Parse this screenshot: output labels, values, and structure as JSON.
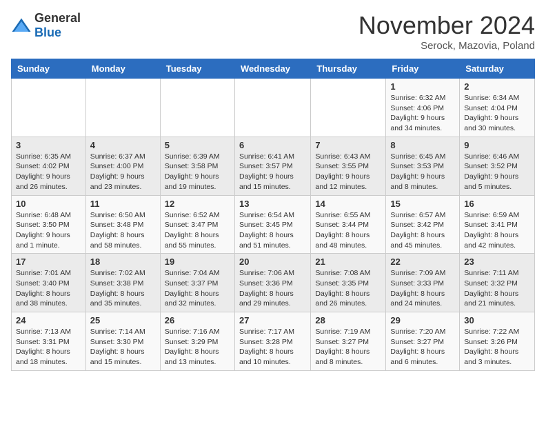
{
  "header": {
    "logo_general": "General",
    "logo_blue": "Blue",
    "month": "November 2024",
    "location": "Serock, Mazovia, Poland"
  },
  "weekdays": [
    "Sunday",
    "Monday",
    "Tuesday",
    "Wednesday",
    "Thursday",
    "Friday",
    "Saturday"
  ],
  "weeks": [
    [
      {
        "day": "",
        "info": ""
      },
      {
        "day": "",
        "info": ""
      },
      {
        "day": "",
        "info": ""
      },
      {
        "day": "",
        "info": ""
      },
      {
        "day": "",
        "info": ""
      },
      {
        "day": "1",
        "info": "Sunrise: 6:32 AM\nSunset: 4:06 PM\nDaylight: 9 hours\nand 34 minutes."
      },
      {
        "day": "2",
        "info": "Sunrise: 6:34 AM\nSunset: 4:04 PM\nDaylight: 9 hours\nand 30 minutes."
      }
    ],
    [
      {
        "day": "3",
        "info": "Sunrise: 6:35 AM\nSunset: 4:02 PM\nDaylight: 9 hours\nand 26 minutes."
      },
      {
        "day": "4",
        "info": "Sunrise: 6:37 AM\nSunset: 4:00 PM\nDaylight: 9 hours\nand 23 minutes."
      },
      {
        "day": "5",
        "info": "Sunrise: 6:39 AM\nSunset: 3:58 PM\nDaylight: 9 hours\nand 19 minutes."
      },
      {
        "day": "6",
        "info": "Sunrise: 6:41 AM\nSunset: 3:57 PM\nDaylight: 9 hours\nand 15 minutes."
      },
      {
        "day": "7",
        "info": "Sunrise: 6:43 AM\nSunset: 3:55 PM\nDaylight: 9 hours\nand 12 minutes."
      },
      {
        "day": "8",
        "info": "Sunrise: 6:45 AM\nSunset: 3:53 PM\nDaylight: 9 hours\nand 8 minutes."
      },
      {
        "day": "9",
        "info": "Sunrise: 6:46 AM\nSunset: 3:52 PM\nDaylight: 9 hours\nand 5 minutes."
      }
    ],
    [
      {
        "day": "10",
        "info": "Sunrise: 6:48 AM\nSunset: 3:50 PM\nDaylight: 9 hours\nand 1 minute."
      },
      {
        "day": "11",
        "info": "Sunrise: 6:50 AM\nSunset: 3:48 PM\nDaylight: 8 hours\nand 58 minutes."
      },
      {
        "day": "12",
        "info": "Sunrise: 6:52 AM\nSunset: 3:47 PM\nDaylight: 8 hours\nand 55 minutes."
      },
      {
        "day": "13",
        "info": "Sunrise: 6:54 AM\nSunset: 3:45 PM\nDaylight: 8 hours\nand 51 minutes."
      },
      {
        "day": "14",
        "info": "Sunrise: 6:55 AM\nSunset: 3:44 PM\nDaylight: 8 hours\nand 48 minutes."
      },
      {
        "day": "15",
        "info": "Sunrise: 6:57 AM\nSunset: 3:42 PM\nDaylight: 8 hours\nand 45 minutes."
      },
      {
        "day": "16",
        "info": "Sunrise: 6:59 AM\nSunset: 3:41 PM\nDaylight: 8 hours\nand 42 minutes."
      }
    ],
    [
      {
        "day": "17",
        "info": "Sunrise: 7:01 AM\nSunset: 3:40 PM\nDaylight: 8 hours\nand 38 minutes."
      },
      {
        "day": "18",
        "info": "Sunrise: 7:02 AM\nSunset: 3:38 PM\nDaylight: 8 hours\nand 35 minutes."
      },
      {
        "day": "19",
        "info": "Sunrise: 7:04 AM\nSunset: 3:37 PM\nDaylight: 8 hours\nand 32 minutes."
      },
      {
        "day": "20",
        "info": "Sunrise: 7:06 AM\nSunset: 3:36 PM\nDaylight: 8 hours\nand 29 minutes."
      },
      {
        "day": "21",
        "info": "Sunrise: 7:08 AM\nSunset: 3:35 PM\nDaylight: 8 hours\nand 26 minutes."
      },
      {
        "day": "22",
        "info": "Sunrise: 7:09 AM\nSunset: 3:33 PM\nDaylight: 8 hours\nand 24 minutes."
      },
      {
        "day": "23",
        "info": "Sunrise: 7:11 AM\nSunset: 3:32 PM\nDaylight: 8 hours\nand 21 minutes."
      }
    ],
    [
      {
        "day": "24",
        "info": "Sunrise: 7:13 AM\nSunset: 3:31 PM\nDaylight: 8 hours\nand 18 minutes."
      },
      {
        "day": "25",
        "info": "Sunrise: 7:14 AM\nSunset: 3:30 PM\nDaylight: 8 hours\nand 15 minutes."
      },
      {
        "day": "26",
        "info": "Sunrise: 7:16 AM\nSunset: 3:29 PM\nDaylight: 8 hours\nand 13 minutes."
      },
      {
        "day": "27",
        "info": "Sunrise: 7:17 AM\nSunset: 3:28 PM\nDaylight: 8 hours\nand 10 minutes."
      },
      {
        "day": "28",
        "info": "Sunrise: 7:19 AM\nSunset: 3:27 PM\nDaylight: 8 hours\nand 8 minutes."
      },
      {
        "day": "29",
        "info": "Sunrise: 7:20 AM\nSunset: 3:27 PM\nDaylight: 8 hours\nand 6 minutes."
      },
      {
        "day": "30",
        "info": "Sunrise: 7:22 AM\nSunset: 3:26 PM\nDaylight: 8 hours\nand 3 minutes."
      }
    ]
  ]
}
